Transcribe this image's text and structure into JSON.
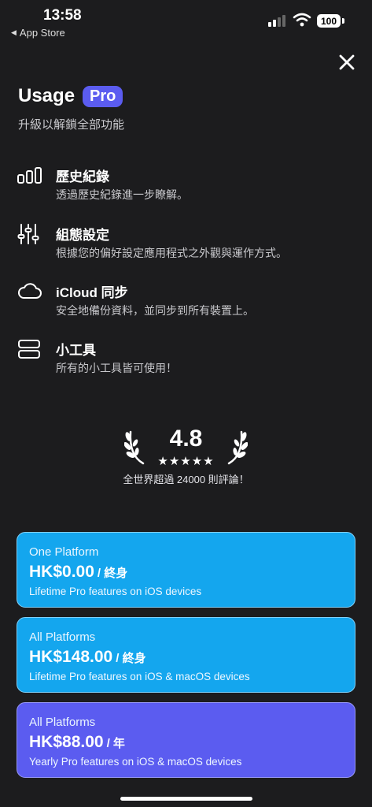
{
  "status_bar": {
    "time": "13:58",
    "back_label": "App Store",
    "battery": "100"
  },
  "header": {
    "title": "Usage",
    "badge": "Pro",
    "subtitle": "升級以解鎖全部功能"
  },
  "features": [
    {
      "icon": "history-bars-icon",
      "title": "歷史紀錄",
      "desc": "透過歷史紀錄進一步瞭解。"
    },
    {
      "icon": "sliders-icon",
      "title": "組態設定",
      "desc": "根據您的偏好設定應用程式之外觀與運作方式。"
    },
    {
      "icon": "cloud-icon",
      "title": "iCloud 同步",
      "desc": "安全地備份資料，並同步到所有裝置上。"
    },
    {
      "icon": "widgets-icon",
      "title": "小工具",
      "desc": "所有的小工具皆可使用！"
    }
  ],
  "rating": {
    "score": "4.8",
    "stars": 4.8,
    "stars_text": "★★★★★",
    "note": "全世界超過 24000 則評論！"
  },
  "plans": [
    {
      "name": "One Platform",
      "price": "HK$0.00",
      "period": "/ 終身",
      "desc": "Lifetime Pro features on iOS devices",
      "color": "#14a6ee"
    },
    {
      "name": "All Platforms",
      "price": "HK$148.00",
      "period": "/ 終身",
      "desc": "Lifetime Pro features on iOS & macOS devices",
      "color": "#14a6ee"
    },
    {
      "name": "All Platforms",
      "price": "HK$88.00",
      "period": "/ 年",
      "desc": "Yearly Pro features on iOS & macOS devices",
      "color": "#5b5cf0"
    }
  ],
  "colors": {
    "background": "#1c1c1e",
    "accent_purple": "#5b5cf0",
    "accent_blue": "#14a6ee"
  }
}
